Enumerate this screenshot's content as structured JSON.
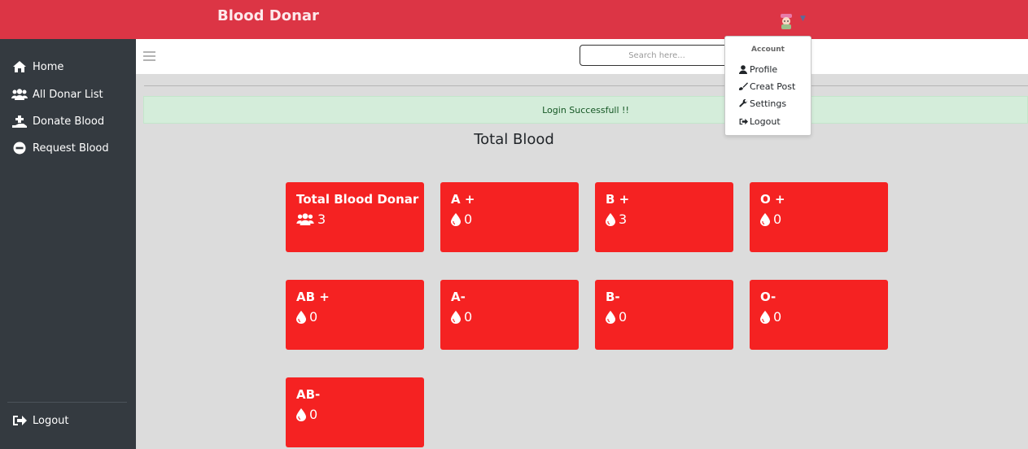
{
  "app": {
    "brand": "Blood Donar"
  },
  "sidebar": {
    "items": [
      {
        "label": "Home",
        "icon": "home-icon"
      },
      {
        "label": "All Donar List",
        "icon": "users-icon"
      },
      {
        "label": "Donate Blood",
        "icon": "donate-hand-icon"
      },
      {
        "label": "Request Blood",
        "icon": "minus-circle-icon"
      }
    ],
    "logout": {
      "label": "Logout",
      "icon": "sign-out-icon"
    }
  },
  "search": {
    "placeholder": "Search here..."
  },
  "alert": {
    "text": "Login Successfull !!"
  },
  "main": {
    "title": "Total Blood"
  },
  "cards": [
    {
      "title": "Total Blood Donar",
      "value": "3",
      "icon": "users-icon"
    },
    {
      "title": "A +",
      "value": "0",
      "icon": "blood-drop-icon"
    },
    {
      "title": "B +",
      "value": "3",
      "icon": "blood-drop-icon"
    },
    {
      "title": "O +",
      "value": "0",
      "icon": "blood-drop-icon"
    },
    {
      "title": "AB +",
      "value": "0",
      "icon": "blood-drop-icon"
    },
    {
      "title": "A-",
      "value": "0",
      "icon": "blood-drop-icon"
    },
    {
      "title": "B-",
      "value": "0",
      "icon": "blood-drop-icon"
    },
    {
      "title": "O-",
      "value": "0",
      "icon": "blood-drop-icon"
    },
    {
      "title": "AB-",
      "value": "0",
      "icon": "blood-drop-icon"
    }
  ],
  "account_menu": {
    "header": "Account",
    "items": [
      {
        "label": "Profile",
        "icon": "user-icon"
      },
      {
        "label": "Creat Post",
        "icon": "brush-icon"
      },
      {
        "label": "Settings",
        "icon": "wrench-icon"
      },
      {
        "label": "Logout",
        "icon": "sign-out-icon"
      }
    ]
  },
  "colors": {
    "topbar": "#dc3545",
    "sidebar": "#343a40",
    "card": "#f52222",
    "alert_bg": "#d4edda",
    "alert_text": "#155724",
    "page_bg": "#dcdcdc"
  }
}
